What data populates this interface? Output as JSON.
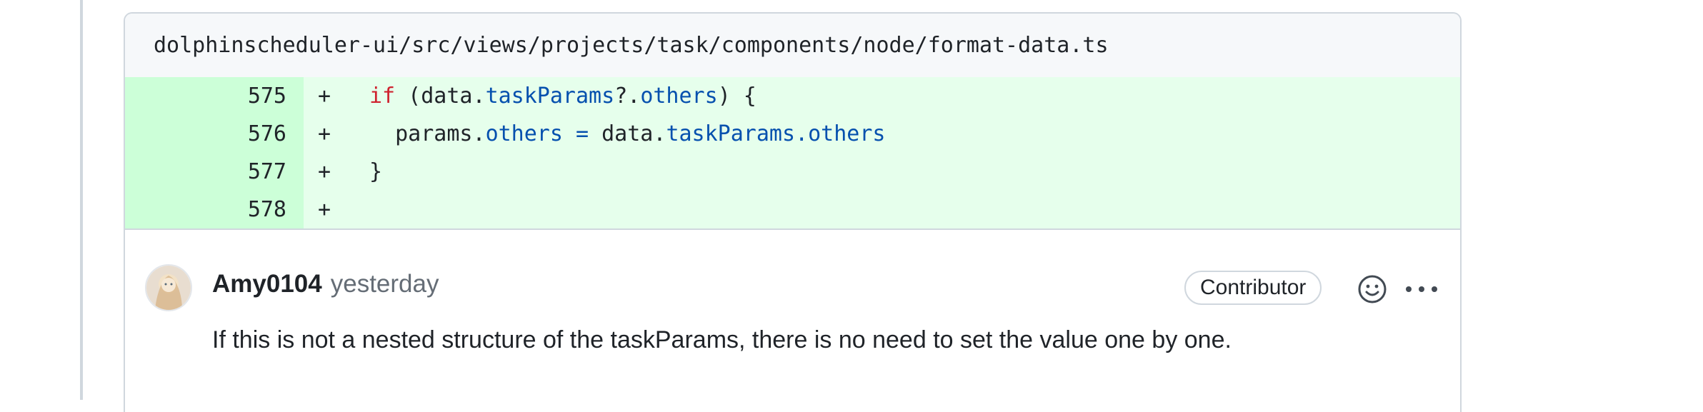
{
  "file": {
    "path": "dolphinscheduler-ui/src/views/projects/task/components/node/format-data.ts"
  },
  "diff": {
    "rows": [
      {
        "line": "575",
        "marker": "+"
      },
      {
        "line": "576",
        "marker": "+"
      },
      {
        "line": "577",
        "marker": "+"
      },
      {
        "line": "578",
        "marker": "+"
      }
    ],
    "code": {
      "l575": {
        "kw": "if",
        "p1": " (data.",
        "prop1": "taskParams",
        "p2": "?.",
        "prop2": "others",
        "p3": ") {"
      },
      "l576": {
        "p1": "  params.",
        "prop1": "others",
        "op": " = ",
        "p2": "data.",
        "prop2": "taskParams",
        "p3": ".",
        "prop3": "others"
      },
      "l577": {
        "p1": "}"
      }
    }
  },
  "comment": {
    "author": "Amy0104",
    "time": "yesterday",
    "badge": "Contributor",
    "body": "If this is not a nested structure of the taskParams, there is no need to set the value one by one."
  },
  "icons": {
    "emoji": "smiley-icon",
    "more": "kebab-horizontal-icon"
  },
  "colors": {
    "addition_line": "#ccffd8",
    "addition_code": "#e6ffec",
    "keyword": "#cf222e",
    "property": "#0550ae"
  }
}
